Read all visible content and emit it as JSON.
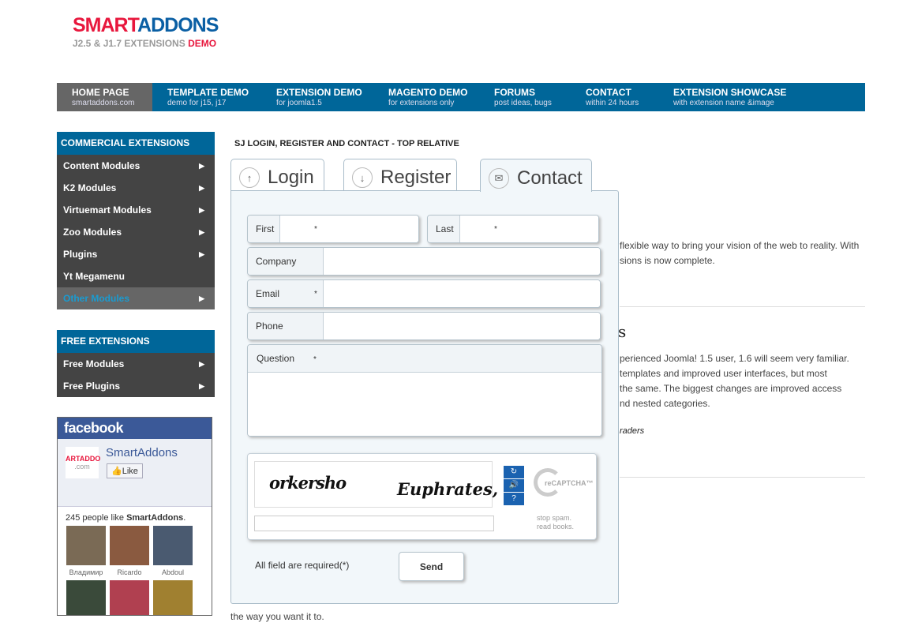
{
  "logo": {
    "part1": "SMART",
    "part2": "ADDONS",
    "tagline": "J2.5 & J1.7 EXTENSIONS",
    "tagline_highlight": "DEMO"
  },
  "nav": [
    {
      "title": "HOME PAGE",
      "sub": "smartaddons.com",
      "active": true
    },
    {
      "title": "TEMPLATE DEMO",
      "sub": "demo for j15, j17"
    },
    {
      "title": "EXTENSION DEMO",
      "sub": "for joomla1.5"
    },
    {
      "title": "MAGENTO DEMO",
      "sub": "for extensions only"
    },
    {
      "title": "FORUMS",
      "sub": "post ideas, bugs"
    },
    {
      "title": "CONTACT",
      "sub": "within 24 hours"
    },
    {
      "title": "EXTENSION SHOWCASE",
      "sub": "with extension name &image"
    }
  ],
  "sidebar": {
    "commercial": {
      "title": "COMMERCIAL EXTENSIONS",
      "items": [
        "Content Modules",
        "K2 Modules",
        "Virtuemart Modules",
        "Zoo Modules",
        "Plugins",
        "Yt Megamenu",
        "Other Modules"
      ]
    },
    "free": {
      "title": "FREE EXTENSIONS",
      "items": [
        "Free Modules",
        "Free Plugins"
      ]
    }
  },
  "facebook": {
    "brand": "facebook",
    "page_name": "SmartAddons",
    "logo_text": "ARTADDO",
    "logo_sub": ".com",
    "like": "Like",
    "count_text": "245 people like ",
    "count_name": "SmartAddons",
    "count_end": ".",
    "faces": [
      "Владимир",
      "Ricardo",
      "Abdoul",
      "",
      "",
      ""
    ]
  },
  "module_title": "SJ LOGIN, REGISTER AND CONTACT - TOP RELATIVE",
  "tabs": [
    {
      "label": "Login",
      "icon": "arrow-up-icon"
    },
    {
      "label": "Register",
      "icon": "arrow-down-icon"
    },
    {
      "label": "Contact",
      "icon": "envelope-icon",
      "active": true
    }
  ],
  "form": {
    "first_name": "First name",
    "last_name": "Last name",
    "company": "Company",
    "email": "Email",
    "phone": "Phone",
    "question": "Question",
    "required_mark": "*",
    "required_note": "All field are required(*)",
    "send": "Send"
  },
  "captcha": {
    "word1": "orkersho",
    "word2": "Euphrates,",
    "brand": "reCAPTCHA™",
    "slogan1": "stop spam.",
    "slogan2": "read books.",
    "refresh": "↻",
    "audio": "🔊",
    "help": "?"
  },
  "background_text": {
    "l1": "flexible way to bring your vision of the web to reality. With",
    "l2": "sions is now complete.",
    "heading": "s",
    "p1": "perienced Joomla! 1.5 user, 1.6 will seem very familiar.",
    "p2": "templates and improved user interfaces, but most",
    "p3": "the same. The biggest changes are improved access",
    "p4": "nd nested categories.",
    "italic": "raders",
    "bottom": "the way you want it to."
  },
  "colors": {
    "brand_blue": "#006699",
    "brand_red": "#e8173d",
    "menu_dark": "#444444",
    "panel": "#f2f7fa"
  }
}
